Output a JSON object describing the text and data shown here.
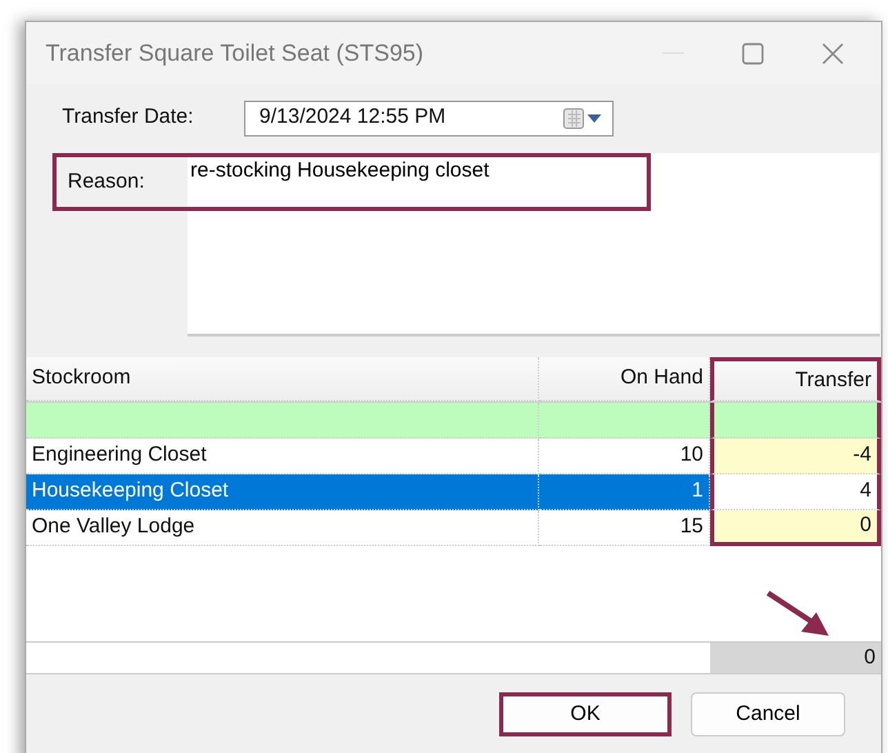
{
  "window": {
    "title": "Transfer Square Toilet Seat (STS95)"
  },
  "transfer_date": {
    "label": "Transfer Date:",
    "value": "9/13/2024 12:55 PM"
  },
  "reason": {
    "label": "Reason:",
    "value": "re-stocking Housekeeping closet",
    "highlighted": true
  },
  "table": {
    "columns": [
      {
        "label": "Stockroom",
        "highlighted": false
      },
      {
        "label": "On Hand",
        "highlighted": false
      },
      {
        "label": "Transfer",
        "highlighted": true
      }
    ],
    "rows": [
      {
        "cells": [
          "Engineering Closet",
          "10",
          "-4"
        ],
        "selected": false
      },
      {
        "cells": [
          "Housekeeping Closet",
          "1",
          "4"
        ],
        "selected": true
      },
      {
        "cells": [
          "One Valley Lodge",
          "15",
          "0"
        ],
        "selected": false
      }
    ],
    "total": {
      "value": "0",
      "highlighted": true
    }
  },
  "buttons": [
    {
      "label": "OK",
      "highlighted": true
    },
    {
      "label": "Cancel",
      "highlighted": false
    }
  ]
}
